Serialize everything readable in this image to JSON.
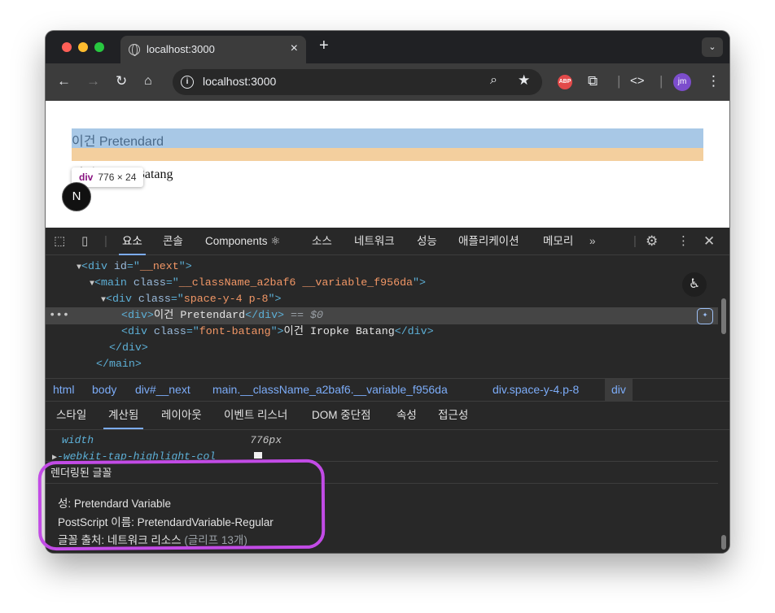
{
  "browser": {
    "tab_title": "localhost:3000",
    "tab_close": "×",
    "new_tab": "+",
    "tab_menu": "⌄",
    "url": "localhost:3000",
    "extension_badge": "ABP",
    "profile_initials": "jm",
    "icons": [
      "back-arrow-icon",
      "forward-arrow-icon",
      "reload-icon",
      "home-icon",
      "site-info-icon",
      "zoom-icon",
      "bookmark-star-icon",
      "extensions-icon",
      "devtools-code-icon",
      "kebab-menu-icon"
    ]
  },
  "page": {
    "line1": "이건 Pretendard",
    "line2": "이건 Iropke Batang",
    "inspect_tooltip": {
      "tag": "div",
      "size": "776 × 24"
    },
    "next_badge": "N"
  },
  "devtools": {
    "panel_tabs": [
      "요소",
      "콘솔",
      "Components ⚛",
      "소스",
      "네트워크",
      "성능",
      "애플리케이션",
      "메모리"
    ],
    "active_panel": "요소",
    "more_tabs": "»",
    "dom": {
      "line1": {
        "open": "<div ",
        "attr": "id",
        "eq": "=\"",
        "val": "__next",
        "close": "\">"
      },
      "line2": {
        "open": "<main ",
        "attr": "class",
        "eq": "=\"",
        "val": "__className_a2baf6 __variable_f956da",
        "close": "\">"
      },
      "line3": {
        "open": "<div ",
        "attr": "class",
        "eq": "=\"",
        "val": "space-y-4 p-8",
        "close": "\">"
      },
      "line4": {
        "open": "<div>",
        "text": "이건 Pretendard",
        "close": "</div>",
        "marker": " == $0"
      },
      "line5": {
        "open": "<div ",
        "attr": "class",
        "eq": "=\"",
        "val": "font-batang",
        "close": "\">",
        "text": "이건 Iropke Batang",
        "end": "</div>"
      },
      "line6": "</div>",
      "line7": "</main>"
    },
    "breadcrumbs": [
      "html",
      "body",
      "div#__next",
      "main.__className_a2baf6.__variable_f956da",
      "div.space-y-4.p-8",
      "div"
    ],
    "sub_tabs": [
      "스타일",
      "계산됨",
      "레이아웃",
      "이벤트 리스너",
      "DOM 중단점",
      "속성",
      "접근성"
    ],
    "active_sub_tab": "계산됨",
    "computed": {
      "prop1_name": "width",
      "prop1_value": "776px",
      "prop2_name": "-webkit-tap-highlight-col",
      "rendered_fonts_header": "렌더링된 글꼴",
      "family_label": "성: Pretendard Variable",
      "postscript_label": "PostScript 이름: PretendardVariable-Regular",
      "source_label": "글꼴 출처: 네트워크 리소스",
      "glyph_count": "(글리프 13개)"
    }
  },
  "colors": {
    "annotation_marker": "#c24be6",
    "content_highlight": "#a8c8e6",
    "margin_highlight": "#f3cf9e",
    "devtools_bg": "#282828",
    "accent": "#7cacf8"
  }
}
